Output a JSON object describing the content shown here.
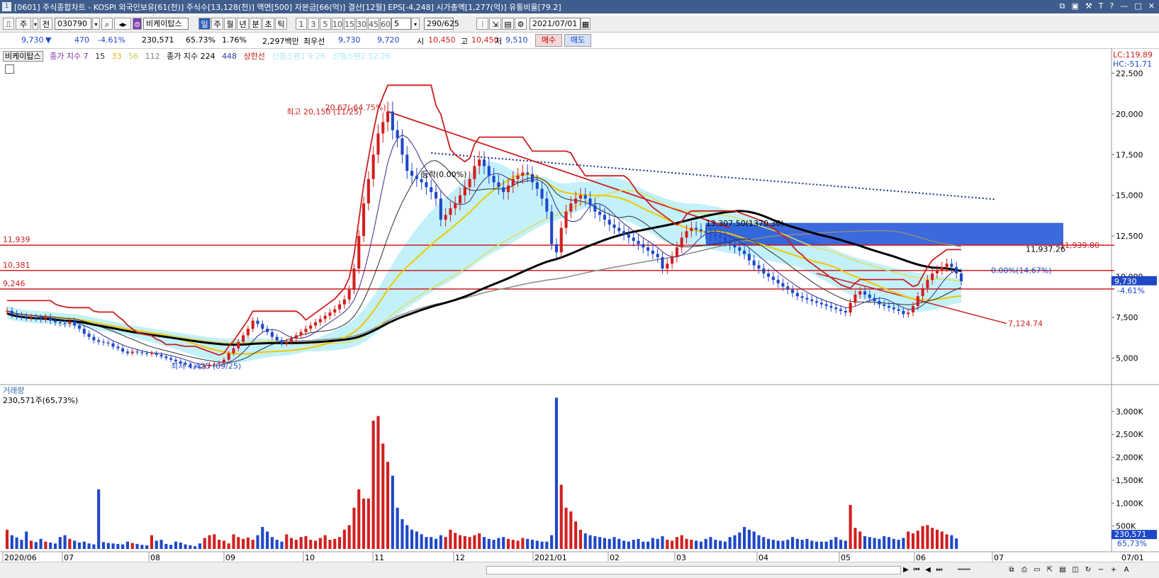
{
  "window": {
    "title": "[0601] 주식종합차트 - KOSPI 외국인보유[61(천)] 주식수[13,128(천)] 액면[500] 자본금[66(억)] 결산[12월] EPS[-4,248] 시가총액[1,277(억)] 유통비율[79.2]",
    "icon_label": "1"
  },
  "toolbar": {
    "type_label": "주",
    "scope_label": "전",
    "code_value": "030790",
    "stock_name": "비케이탑스",
    "periods": [
      "일",
      "주",
      "월",
      "년",
      "분",
      "초",
      "틱"
    ],
    "selected_period": "일",
    "intervals": [
      "1",
      "3",
      "5",
      "10",
      "15",
      "30",
      "45",
      "60"
    ],
    "interval_value": "5",
    "count_value": "290",
    "count_total": "/625",
    "date_value": "2021/07/01"
  },
  "quote": {
    "price": "9,730",
    "direction": "▼",
    "change": "470",
    "change_pct": "-4.61%",
    "volume": "230,571",
    "volume_ratio": "65.73%",
    "turnover": "1.76%",
    "amount": "2,297백만",
    "best_ask_label": "최우선",
    "best_ask": "9,730",
    "best_bid": "9,720",
    "open_label": "시",
    "open": "10,450",
    "high_label": "고",
    "high": "10,450",
    "low_label": "저",
    "low": "9,510",
    "buy_label": "매수",
    "sell_label": "매도"
  },
  "legend": {
    "stock": "비케이탑스",
    "ma_label": "종가 지수 7",
    "ma15": "15",
    "ma33": "33",
    "ma56": "56",
    "ma112": "112",
    "ma_long_label": "종가 지수 224",
    "ma448": "448",
    "limit_label": "상한선",
    "cloud1": "선행스팬1 9.26",
    "cloud2": "선행스팬2 52.26"
  },
  "colors": {
    "up": "#d21f1f",
    "down": "#1f48c8",
    "ma7": "#3a2a8a",
    "ma15": "#2f2f2f",
    "ma33": "#f0c800",
    "ma56": "#dede60",
    "ma112": "#8a8a8a",
    "ma224": "#000000",
    "upper_band": "#cc1e1e",
    "cloud": "#bdf0fa",
    "zone": "#1a4fd6"
  },
  "chart_data": [
    {
      "type": "candlestick",
      "title": "",
      "x_ticks": [
        "2020/06",
        "07",
        "08",
        "09",
        "10",
        "11",
        "12",
        "2021/01",
        "02",
        "03",
        "04",
        "05",
        "06",
        "07"
      ],
      "x_tick_right": "07/01",
      "y_ticks": [
        22500,
        20000,
        17500,
        15000,
        12500,
        10000,
        7500,
        5000
      ],
      "ylim": [
        3500,
        23300
      ],
      "y_side_label_top": "LC:119.89",
      "y_side_label_bottom": "HC:-51.71",
      "last_price_tag": "9,730",
      "last_change_tag": "-4.61%",
      "horizontal_lines": [
        {
          "label": "11,939",
          "value": 11939
        },
        {
          "label": "10,381",
          "value": 10381
        },
        {
          "label": "9,246",
          "value": 9246
        }
      ],
      "annotations": [
        {
          "text": "최고 20,150 (11/25)",
          "value": 20150
        },
        {
          "text": "20.67(-64.75%)",
          "value": 20400
        },
        {
          "text": "최저 4,425 (09/25)",
          "value": 4425
        },
        {
          "text": "11,939.80",
          "value": 11939.8
        },
        {
          "text": "11,937.26",
          "value": 11700
        },
        {
          "text": "13,307.50(1370.30)",
          "value": 13300
        },
        {
          "text": "등락(0.00%)",
          "value": 16300
        },
        {
          "text": "0.00%(14.67%)",
          "value": 10400
        },
        {
          "text": "7,124.74",
          "value": 7124.74
        }
      ],
      "close_series": [
        7900,
        7700,
        7600,
        7550,
        7500,
        7500,
        7450,
        7400,
        7500,
        7300,
        7200,
        7150,
        7100,
        7250,
        7000,
        6800,
        6500,
        6300,
        6100,
        6000,
        5950,
        5900,
        5700,
        5600,
        5400,
        5300,
        5400,
        5350,
        5300,
        5250,
        5300,
        5200,
        5100,
        5000,
        4900,
        4800,
        4700,
        4600,
        4500,
        4450,
        4425,
        4500,
        4600,
        4650,
        4700,
        4900,
        5300,
        5600,
        6000,
        6400,
        6800,
        7300,
        7100,
        6800,
        6600,
        6300,
        6100,
        5900,
        6000,
        6200,
        6400,
        6600,
        6800,
        7000,
        7200,
        7400,
        7600,
        7800,
        8000,
        8300,
        8600,
        9200,
        10500,
        12500,
        14500,
        16000,
        17500,
        18800,
        19500,
        20150,
        19000,
        18500,
        17500,
        16500,
        16200,
        16000,
        15800,
        15500,
        15200,
        14800,
        13500,
        13800,
        14200,
        14500,
        15000,
        15500,
        16000,
        16800,
        17200,
        16800,
        16200,
        15800,
        15500,
        15200,
        15600,
        16000,
        16200,
        16400,
        16300,
        15800,
        15400,
        14800,
        14000,
        12000,
        11500,
        13000,
        14000,
        14500,
        14800,
        15000,
        14800,
        14400,
        14000,
        13800,
        13500,
        13200,
        13000,
        12800,
        12600,
        12400,
        12200,
        12000,
        11800,
        11600,
        11400,
        11200,
        10500,
        10800,
        11200,
        11800,
        12400,
        12800,
        13000,
        12900,
        12800,
        12700,
        12600,
        12500,
        12400,
        12200,
        12000,
        11800,
        11600,
        11400,
        11000,
        10700,
        10500,
        10200,
        10000,
        9800,
        9600,
        9400,
        9200,
        9000,
        8800,
        8700,
        8600,
        8500,
        8400,
        8300,
        8200,
        8100,
        8000,
        7900,
        7800,
        8400,
        8900,
        9100,
        8900,
        8700,
        8500,
        8300,
        8200,
        8100,
        8000,
        7900,
        7700,
        7800,
        8200,
        8800,
        9300,
        9800,
        10200,
        10400,
        10600,
        10800,
        10600,
        10200,
        9730
      ]
    },
    {
      "type": "bar",
      "title": "거래량",
      "value_label": "230,571주(65,73%)",
      "y_ticks": [
        "3,000K",
        "2,500K",
        "2,000K",
        "1,500K",
        "1,000K",
        "500K"
      ],
      "y_tick_values": [
        3000,
        2500,
        2000,
        1500,
        1000,
        500
      ],
      "last_volume_tag": "230,571",
      "last_volume_ratio_tag": "65,73%",
      "ylim": [
        0,
        3400
      ],
      "values": [
        420,
        300,
        250,
        200,
        380,
        180,
        150,
        220,
        160,
        140,
        120,
        260,
        300,
        220,
        180,
        140,
        160,
        120,
        100,
        1300,
        150,
        130,
        120,
        110,
        100,
        160,
        130,
        110,
        90,
        80,
        300,
        180,
        200,
        110,
        90,
        160,
        140,
        100,
        80,
        60,
        120,
        240,
        300,
        320,
        200,
        180,
        120,
        320,
        260,
        220,
        250,
        200,
        300,
        480,
        380,
        260,
        200,
        160,
        320,
        240,
        200,
        260,
        280,
        200,
        180,
        240,
        300,
        200,
        220,
        260,
        420,
        520,
        900,
        1300,
        1100,
        1100,
        2800,
        2900,
        2300,
        1900,
        1600,
        900,
        650,
        520,
        420,
        380,
        320,
        260,
        260,
        220,
        300,
        260,
        420,
        350,
        300,
        280,
        260,
        300,
        340,
        260,
        220,
        200,
        240,
        260,
        220,
        200,
        180,
        240,
        220,
        200,
        180,
        160,
        160,
        300,
        3300,
        1400,
        900,
        820,
        600,
        420,
        340,
        300,
        280,
        260,
        240,
        220,
        260,
        220,
        180,
        160,
        200,
        220,
        160,
        160,
        240,
        220,
        280,
        200,
        180,
        260,
        300,
        220,
        200,
        180,
        160,
        220,
        260,
        200,
        180,
        160,
        260,
        300,
        360,
        480,
        420,
        380,
        300,
        260,
        220,
        200,
        180,
        180,
        200,
        260,
        220,
        200,
        220,
        180,
        160,
        160,
        160,
        200,
        260,
        200,
        180,
        960,
        460,
        380,
        280,
        260,
        240,
        220,
        280,
        260,
        220,
        200,
        240,
        380,
        340,
        400,
        500,
        520,
        460,
        420,
        380,
        320,
        300,
        230
      ]
    }
  ],
  "volume_panel": {
    "label": "거래량",
    "value": "230,571주(65,73%)"
  }
}
